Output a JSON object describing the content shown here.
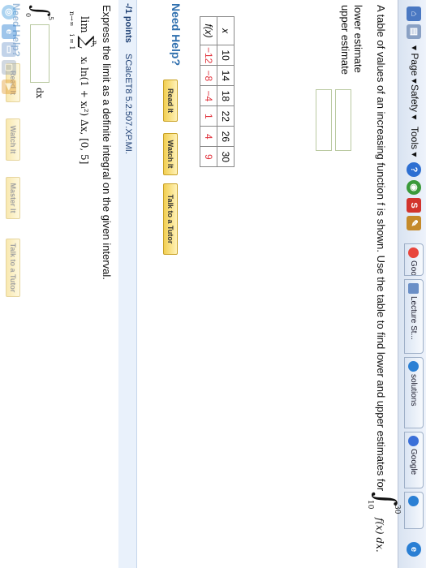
{
  "toolbar": {
    "page_label": "Page",
    "safety_label": "Safety",
    "tools_label": "Tools",
    "tabs": [
      {
        "label": "Google"
      },
      {
        "label": "Lecture St..."
      },
      {
        "label": "solutions"
      },
      {
        "label": "Google"
      },
      {
        "label": ""
      }
    ]
  },
  "q1": {
    "prompt": "A table of values of an increasing function f is shown. Use the table to find lower and upper estimates for",
    "integral_upper": "30",
    "integral_lower": "10",
    "integrand": "f(x) dx.",
    "lower_label": "lower estimate",
    "upper_label": "upper estimate",
    "table": {
      "x_header": "x",
      "fx_header": "f(x)",
      "x": [
        "10",
        "14",
        "18",
        "22",
        "26",
        "30"
      ],
      "fx": [
        "−12",
        "−8",
        "−4",
        "1",
        "4",
        "9"
      ]
    },
    "need_help": "Need Help?",
    "buttons": {
      "read": "Read It",
      "watch": "Watch It",
      "talk": "Talk to a Tutor"
    }
  },
  "q2": {
    "points": "-/1 points",
    "source": "SCalcET8 5.2.507.XP.MI.",
    "prompt": "Express the limit as a definite integral on the given interval.",
    "lim": "lim",
    "lim_sub": "n→∞",
    "sum_top": "n",
    "sum_bot": "i = 1",
    "expr": "xᵢ ln(1 + xᵢ²) Δx, [0, 5]",
    "int_upper": "5",
    "int_lower": "0",
    "dx": "dx",
    "need_help": "Need Help?",
    "buttons": {
      "read": "Read It",
      "watch": "Watch It",
      "master": "Master It",
      "talk": "Talk to a Tutor"
    }
  },
  "colors": {
    "accent": "#2f6fae",
    "button": "#f2cf52",
    "negative": "#e0323c"
  }
}
